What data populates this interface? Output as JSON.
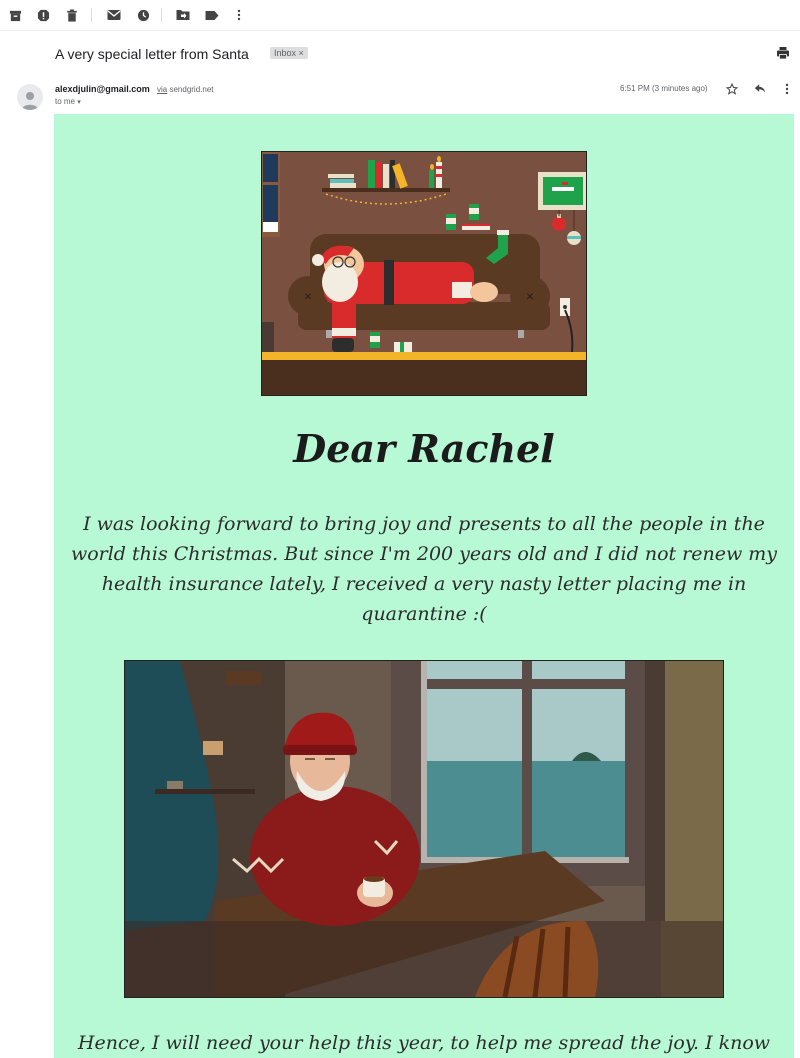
{
  "toolbar": {
    "icons": [
      "archive-icon",
      "report-spam-icon",
      "delete-icon",
      "mark-unread-icon",
      "snooze-icon",
      "move-to-icon",
      "labels-icon",
      "more-vert-icon"
    ]
  },
  "email": {
    "subject": "A very special letter from Santa",
    "label_chip": "Inbox ×",
    "sender": "alexdjulin@gmail.com",
    "via_text": "via",
    "via_domain": "sendgrid.net",
    "to_line": "to me",
    "time": "6:51 PM (3 minutes ago)"
  },
  "letter": {
    "greeting": "Dear Rachel",
    "paragraph1": "I was looking forward to bring joy and presents to all the people in the world this Christmas. But since I'm 200 years old and I did not renew my health insurance lately, I received a very nasty letter placing me in quarantine :(",
    "paragraph2": "Hence, I will need your help this year, to help me spread the joy. I know"
  },
  "colors": {
    "email_background": "#b8f9d5",
    "sofa_room_wall": "#7a5040",
    "santa_red": "#d92b2b",
    "floor_yellow": "#f4b42a"
  }
}
